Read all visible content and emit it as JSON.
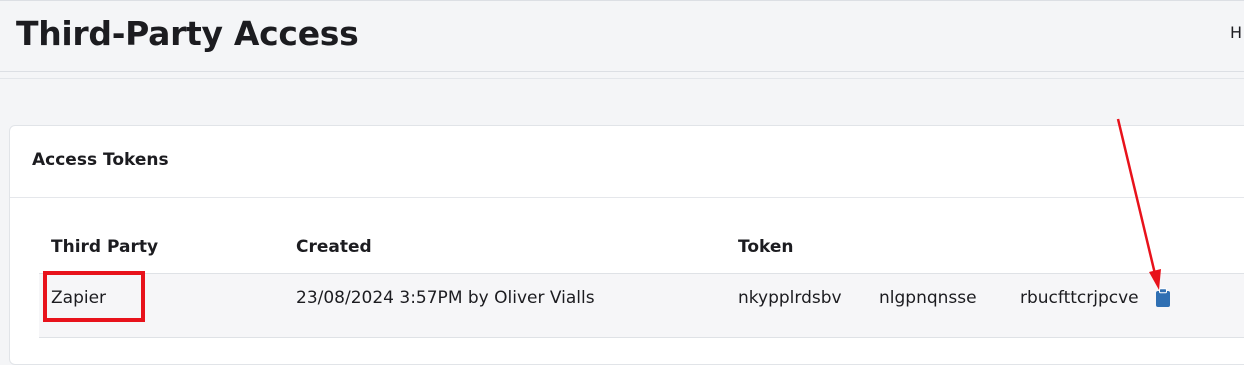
{
  "header": {
    "title": "Third-Party Access",
    "user_initial": "H"
  },
  "card": {
    "title": "Access Tokens",
    "columns": [
      "Third Party",
      "Created",
      "Token"
    ],
    "rows": [
      {
        "third_party": "Zapier",
        "created": "23/08/2024 3:57PM by Oliver Vialls",
        "token_parts": [
          "nkypplrdsbv",
          "nlgpnqnsse",
          "rbucfttcrjpcve"
        ]
      }
    ]
  },
  "annotations": {
    "highlight_color": "#e8121b",
    "arrow_color": "#e8121b"
  },
  "icons": {
    "copy": "clipboard-icon"
  },
  "colors": {
    "icon_blue": "#2f6fb3"
  }
}
